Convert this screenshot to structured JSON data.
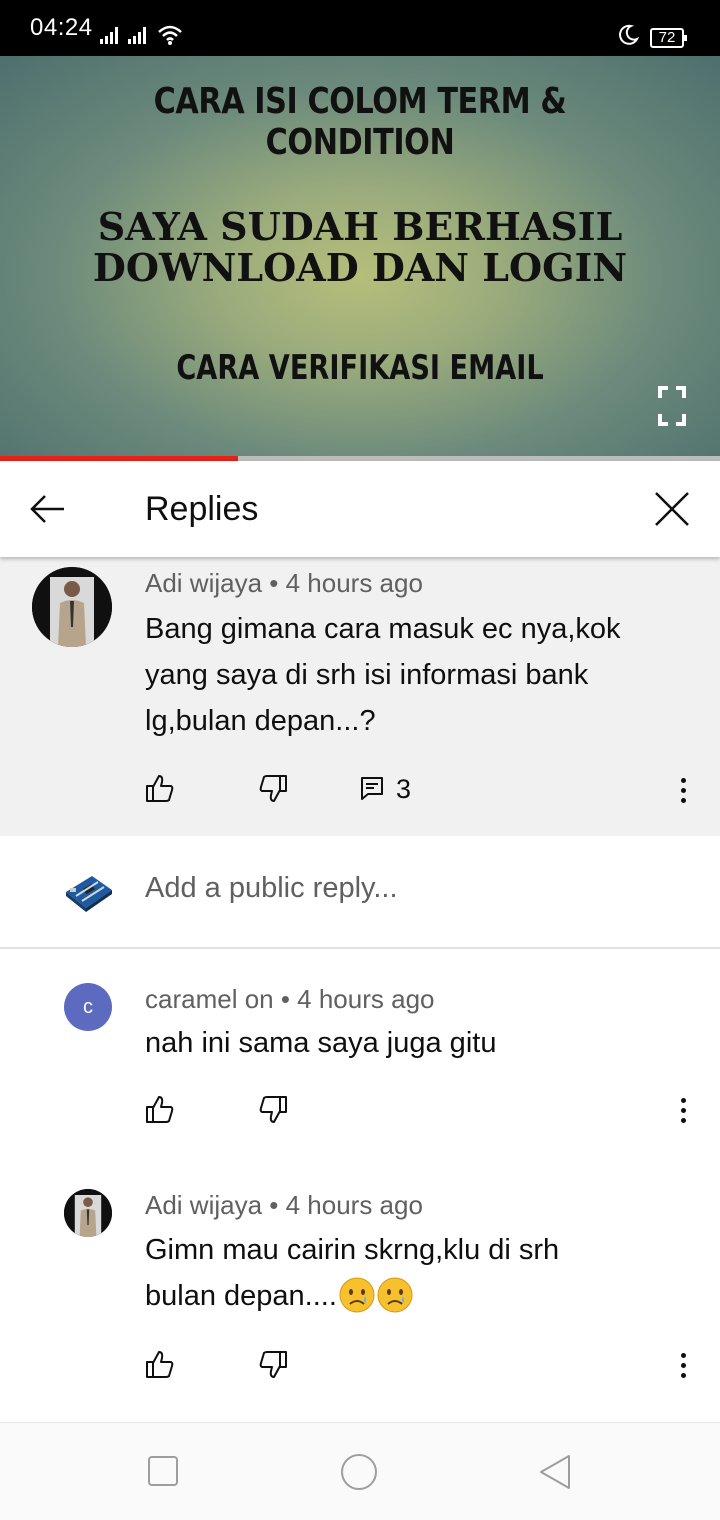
{
  "status_bar": {
    "time": "04:24",
    "battery": "72"
  },
  "video": {
    "line1": "CARA ISI COLOM TERM & CONDITION",
    "line2a": "SAYA SUDAH BERHASIL",
    "line2b": "DOWNLOAD DAN LOGIN",
    "line3": "CARA VERIFIKASI EMAIL",
    "progress_fraction": 0.33
  },
  "header": {
    "title": "Replies"
  },
  "parent_comment": {
    "author_meta": "Adi wijaya • 4 hours ago",
    "text_line1": "Bang gimana cara masuk ec nya,kok",
    "text_line2": "yang saya di srh isi informasi bank",
    "text_line3": "lg,bulan depan...?",
    "reply_count": "3"
  },
  "reply_box": {
    "placeholder": "Add a public reply..."
  },
  "replies": [
    {
      "avatar_letter": "c",
      "author_meta": "caramel on • 4 hours ago",
      "text_line1": "nah ini sama saya juga gitu"
    },
    {
      "author_meta": "Adi wijaya • 4 hours ago",
      "text_line1": "Gimn mau cairin skrng,klu di srh",
      "text_line2": "bulan depan...."
    }
  ],
  "colors": {
    "accent": "#e62117",
    "avatar_c": "#5c6bc0",
    "meta": "#606060"
  }
}
